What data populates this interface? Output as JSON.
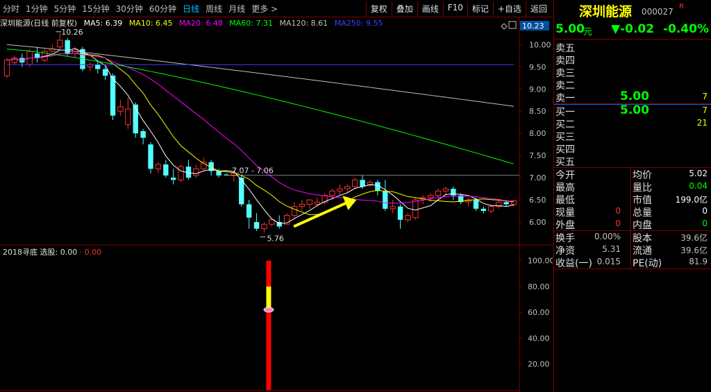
{
  "toolbar": {
    "tabs": [
      "分时",
      "1分钟",
      "5分钟",
      "15分钟",
      "30分钟",
      "60分钟",
      "日线",
      "周线",
      "月线",
      "更多 >"
    ],
    "active_tab": "日线",
    "buttons": [
      "复权",
      "叠加",
      "画线",
      "F10",
      "标记",
      "+自选",
      "返回"
    ]
  },
  "indicators": {
    "title": "深圳能源(日线 前复权)",
    "ma5": "MA5: 6.39",
    "ma10": "MA10: 6.45",
    "ma20": "MA20: 6.48",
    "ma60": "MA60: 7.31",
    "ma120": "MA120: 8.61",
    "ma250": "MA250: 9.55",
    "colors": {
      "ma5": "#ffffff",
      "ma10": "#ffff00",
      "ma20": "#ff00ff",
      "ma60": "#00ff00",
      "ma120": "#c0c0c0",
      "ma250": "#4040ff"
    }
  },
  "sub_indicator": {
    "name": "2018寻底",
    "label": "选股: 0.00",
    "value": "· 0.00"
  },
  "chart_data": [
    {
      "type": "candlestick",
      "price_axis": [
        6.0,
        6.5,
        7.0,
        7.5,
        8.0,
        8.5,
        9.0,
        9.5,
        10.0
      ],
      "ylim": [
        5.5,
        10.35
      ],
      "current_price_tag": "10.23",
      "annotations": {
        "high": "10.26",
        "low": "5.76",
        "range": "7.07 - 7.06"
      },
      "colors": {
        "up": "#ff3030",
        "down": "#54ffff"
      },
      "candles": [
        [
          9.3,
          9.7,
          9.65,
          9.25
        ],
        [
          9.6,
          9.75,
          9.7,
          9.55
        ],
        [
          9.7,
          9.8,
          9.6,
          9.5
        ],
        [
          9.55,
          9.9,
          9.85,
          9.5
        ],
        [
          9.8,
          9.95,
          9.7,
          9.6
        ],
        [
          9.65,
          9.9,
          9.85,
          9.6
        ],
        [
          9.85,
          10.0,
          9.9,
          9.8
        ],
        [
          9.95,
          10.26,
          10.1,
          9.9
        ],
        [
          10.1,
          10.15,
          9.8,
          9.75
        ],
        [
          9.8,
          9.95,
          9.9,
          9.7
        ],
        [
          9.9,
          9.95,
          9.45,
          9.4
        ],
        [
          9.5,
          9.6,
          9.55,
          9.4
        ],
        [
          9.55,
          9.65,
          9.45,
          9.35
        ],
        [
          9.45,
          9.5,
          9.3,
          9.2
        ],
        [
          9.3,
          9.35,
          8.4,
          8.3
        ],
        [
          8.5,
          8.75,
          8.6,
          8.4
        ],
        [
          8.2,
          8.8,
          8.55,
          8.1
        ],
        [
          8.65,
          8.7,
          8.0,
          7.9
        ],
        [
          8.05,
          8.1,
          7.9,
          7.75
        ],
        [
          7.75,
          7.8,
          7.2,
          7.1
        ],
        [
          7.2,
          7.35,
          7.3,
          7.1
        ],
        [
          7.3,
          7.4,
          7.05,
          7.0
        ],
        [
          7.0,
          7.2,
          6.95,
          6.85
        ],
        [
          6.95,
          7.3,
          7.25,
          6.9
        ],
        [
          7.25,
          7.4,
          7.0,
          6.95
        ],
        [
          7.05,
          7.3,
          7.2,
          7.0
        ],
        [
          7.2,
          7.45,
          7.35,
          7.15
        ],
        [
          7.35,
          7.4,
          7.15,
          7.05
        ],
        [
          7.15,
          7.2,
          7.05,
          7.0
        ],
        [
          7.07,
          7.1,
          7.05,
          7.06
        ],
        [
          7.05,
          7.15,
          7.1,
          6.9
        ],
        [
          7.0,
          7.05,
          6.4,
          6.35
        ],
        [
          6.4,
          6.5,
          6.1,
          5.85
        ],
        [
          6.0,
          6.2,
          5.85,
          5.8
        ],
        [
          5.85,
          6.0,
          5.95,
          5.76
        ],
        [
          5.95,
          6.05,
          6.05,
          5.9
        ],
        [
          6.0,
          6.15,
          5.9,
          5.85
        ],
        [
          5.95,
          6.2,
          6.15,
          5.95
        ],
        [
          6.15,
          6.45,
          6.35,
          6.1
        ],
        [
          6.35,
          6.5,
          6.4,
          6.25
        ],
        [
          6.4,
          6.5,
          6.5,
          6.3
        ],
        [
          6.4,
          6.55,
          6.45,
          6.35
        ],
        [
          6.45,
          6.65,
          6.6,
          6.4
        ],
        [
          6.6,
          6.75,
          6.7,
          6.5
        ],
        [
          6.7,
          6.85,
          6.75,
          6.6
        ],
        [
          6.75,
          6.85,
          6.8,
          6.65
        ],
        [
          6.8,
          7.0,
          6.95,
          6.75
        ],
        [
          6.95,
          7.05,
          6.8,
          6.75
        ],
        [
          6.85,
          6.95,
          6.9,
          6.8
        ],
        [
          6.9,
          6.95,
          6.7,
          6.6
        ],
        [
          6.7,
          6.95,
          6.3,
          6.25
        ],
        [
          6.3,
          6.5,
          6.35,
          6.2
        ],
        [
          6.35,
          6.4,
          6.05,
          5.85
        ],
        [
          6.05,
          6.2,
          6.15,
          6.0
        ],
        [
          6.1,
          6.55,
          6.5,
          6.05
        ],
        [
          6.5,
          6.6,
          6.55,
          6.4
        ],
        [
          6.55,
          6.65,
          6.6,
          6.45
        ],
        [
          6.6,
          6.75,
          6.7,
          6.5
        ],
        [
          6.7,
          6.8,
          6.75,
          6.6
        ],
        [
          6.75,
          6.8,
          6.6,
          6.5
        ],
        [
          6.6,
          6.65,
          6.45,
          6.4
        ],
        [
          6.45,
          6.55,
          6.5,
          6.35
        ],
        [
          6.5,
          6.55,
          6.3,
          6.25
        ],
        [
          6.3,
          6.35,
          6.25,
          6.2
        ],
        [
          6.25,
          6.4,
          6.35,
          6.2
        ],
        [
          6.35,
          6.5,
          6.45,
          6.3
        ],
        [
          6.45,
          6.5,
          6.4,
          6.35
        ],
        [
          6.4,
          6.5,
          6.48,
          6.35
        ]
      ]
    },
    {
      "type": "bar",
      "name": "2018寻底",
      "y_axis": [
        20.0,
        40.0,
        60.0,
        80.0,
        100.0
      ],
      "ylim": [
        0,
        103
      ],
      "bar_value": 100,
      "bar_index": 34,
      "segments": [
        {
          "from": 0,
          "to": 60,
          "color": "#ff0000"
        },
        {
          "from": 60,
          "to": 70,
          "color": "#ffff00"
        },
        {
          "from": 70,
          "to": 80,
          "color": "#ffff00"
        },
        {
          "from": 80,
          "to": 100,
          "color": "#ff0000"
        }
      ],
      "marker_value": 62
    }
  ],
  "quote": {
    "name": "深圳能源",
    "code": "000027",
    "r": "R",
    "price": "5.00",
    "unit": "元",
    "change": "▼-0.02",
    "pct": "-0.40%",
    "sell": [
      {
        "label": "卖五",
        "price": "",
        "vol": ""
      },
      {
        "label": "卖四",
        "price": "",
        "vol": ""
      },
      {
        "label": "卖三",
        "price": "",
        "vol": ""
      },
      {
        "label": "卖二",
        "price": "",
        "vol": ""
      },
      {
        "label": "卖一",
        "price": "5.00",
        "vol": "7"
      }
    ],
    "buy": [
      {
        "label": "买一",
        "price": "5.00",
        "vol": "7"
      },
      {
        "label": "买二",
        "price": "",
        "vol": "21"
      },
      {
        "label": "买三",
        "price": "",
        "vol": ""
      },
      {
        "label": "买四",
        "price": "",
        "vol": ""
      },
      {
        "label": "买五",
        "price": "",
        "vol": ""
      }
    ],
    "stats": [
      {
        "l1": "今开",
        "v1": "",
        "l2": "均价",
        "v2": "5.02",
        "c1": "#c0c0c0",
        "c2": "#ffffff"
      },
      {
        "l1": "最高",
        "v1": "",
        "l2": "量比",
        "v2": "0.04",
        "c1": "#c0c0c0",
        "c2": "#00ff00"
      },
      {
        "l1": "最低",
        "v1": "",
        "l2": "市值",
        "v2": "199.0亿",
        "c1": "#c0c0c0",
        "c2": "#ffffff"
      },
      {
        "l1": "现量",
        "v1": "0",
        "l2": "总量",
        "v2": "0",
        "c1": "#ff3030",
        "c2": "#ffffff"
      },
      {
        "l1": "外盘",
        "v1": "0",
        "l2": "内盘",
        "v2": "0",
        "c1": "#ff3030",
        "c2": "#00ff00"
      }
    ],
    "fin": [
      {
        "l1": "换手",
        "v1": "0.00%",
        "l2": "股本",
        "v2": "39.6亿"
      },
      {
        "l1": "净资",
        "v1": "5.31",
        "l2": "流通",
        "v2": "39.6亿"
      },
      {
        "l1": "收益(一)",
        "v1": "0.015",
        "l2": "PE(动)",
        "v2": "81.9"
      }
    ]
  }
}
